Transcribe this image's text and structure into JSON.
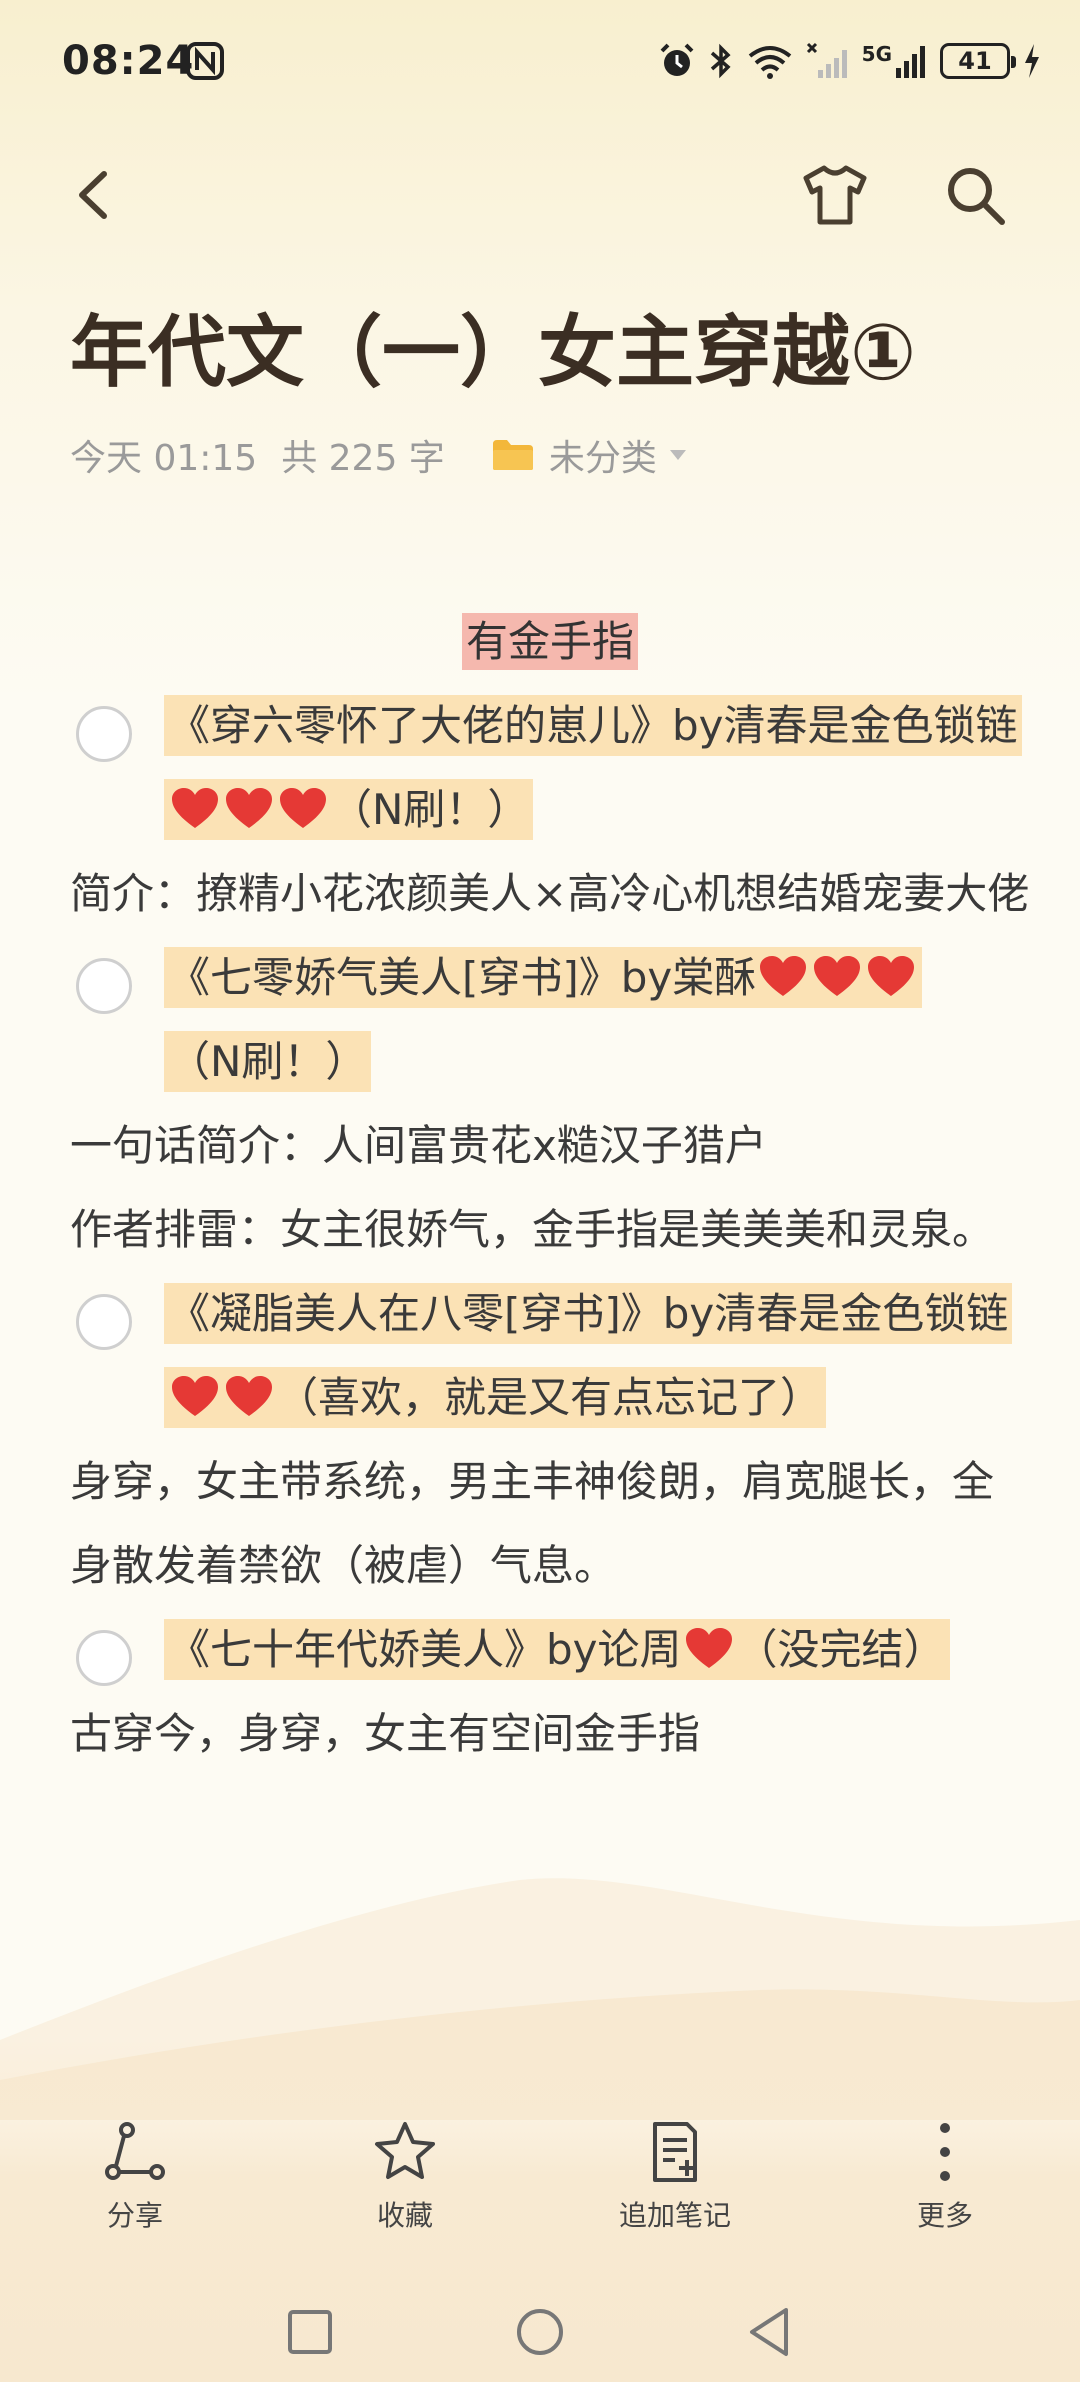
{
  "status_bar": {
    "time": "08:24",
    "network": "5G",
    "battery": "41"
  },
  "note": {
    "title": "年代文（一）女主穿越①",
    "meta_date": "今天 01:15",
    "meta_count": "共 225 字",
    "folder": "未分类"
  },
  "content": {
    "heading": "有金手指",
    "items": [
      {
        "book": "《穿六零怀了大佬的崽儿》by清春是金色锁链",
        "note": "（N刷！）",
        "desc": "简介：撩精小花浓颜美人×高冷心机想结婚宠妻大佬"
      },
      {
        "book": "《七零娇气美人[穿书]》by棠酥",
        "note": "（N刷！）",
        "desc1": "一句话简介：人间富贵花x糙汉子猎户",
        "desc2": "作者排雷：女主很娇气，金手指是美美美和灵泉。"
      },
      {
        "book": "《凝脂美人在八零[穿书]》by清春是金色锁链",
        "note": "（喜欢，就是又有点忘记了）",
        "desc": "身穿，女主带系统，男主丰神俊朗，肩宽腿长，全身散发着禁欲（被虐）气息。"
      },
      {
        "book": "《七十年代娇美人》by论周",
        "note": "（没完结）",
        "desc": "古穿今，身穿，女主有空间金手指"
      }
    ]
  },
  "toolbar": {
    "share": "分享",
    "favorite": "收藏",
    "append": "追加笔记",
    "more": "更多"
  },
  "colors": {
    "highlight_yellow": "#fbe2b5",
    "highlight_pink": "#f5b8ae",
    "heart": "#e53935",
    "folder": "#f3b73a"
  }
}
